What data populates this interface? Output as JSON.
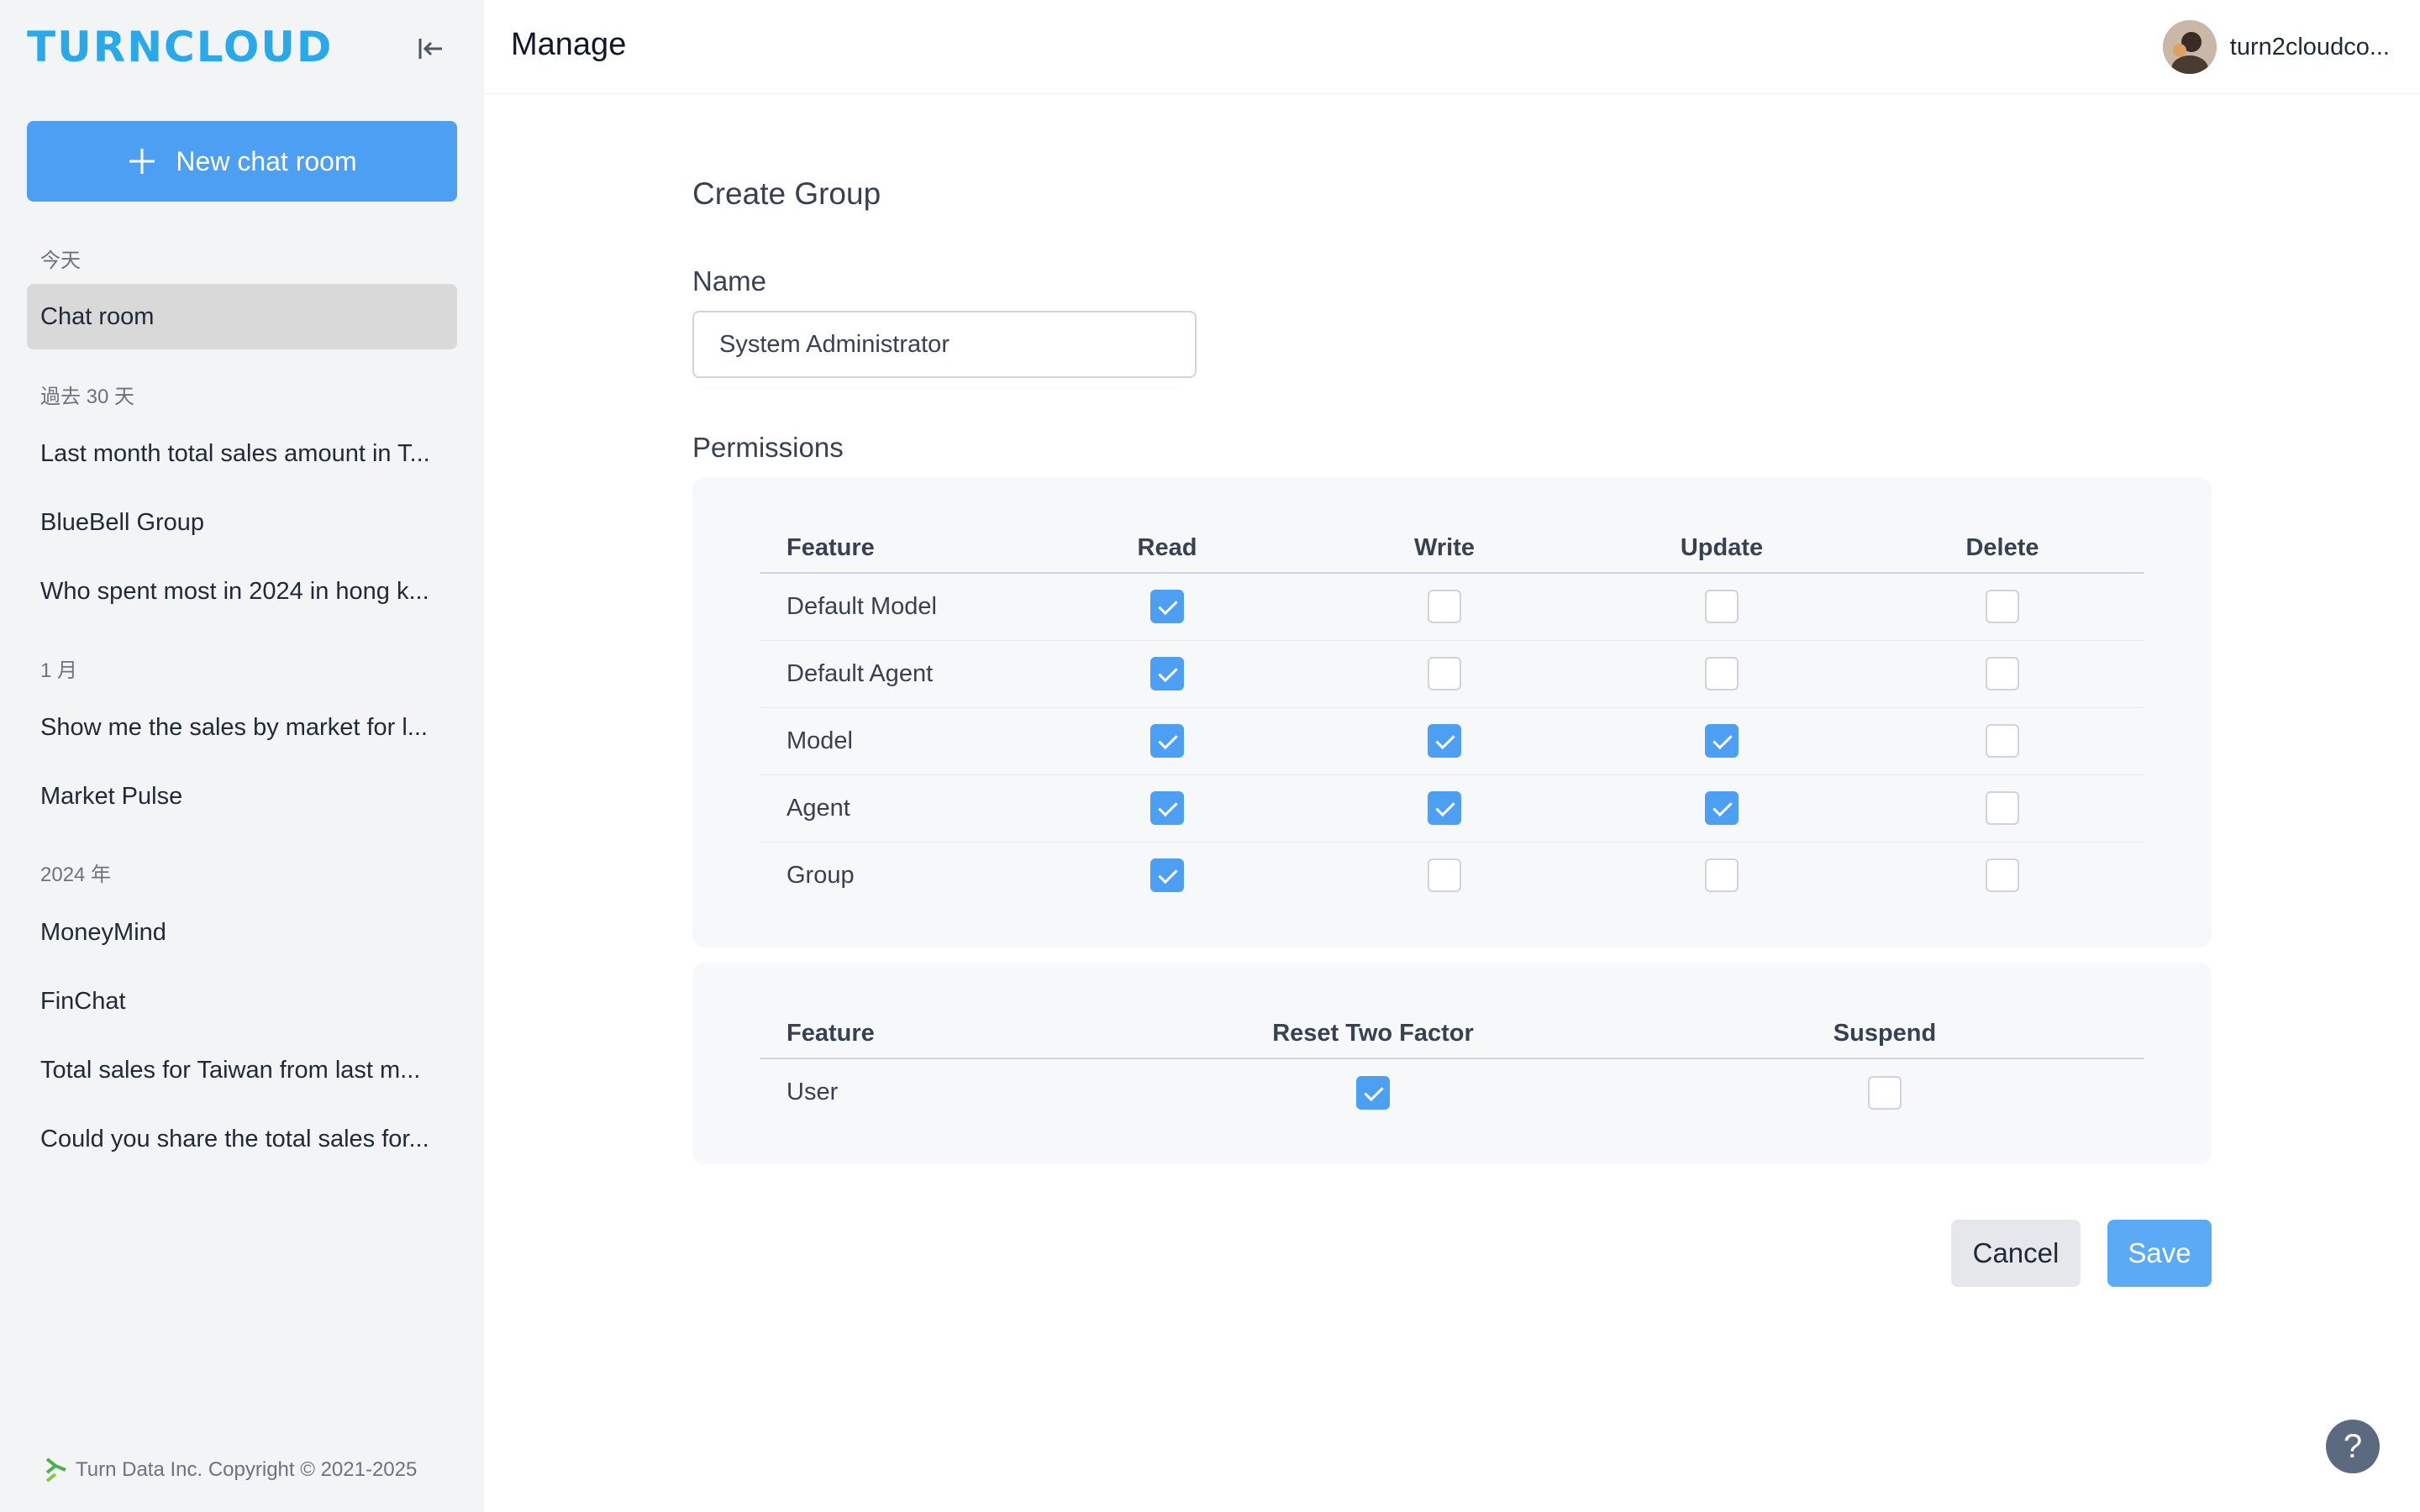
{
  "sidebar": {
    "logo_text": "TURNCLOUD",
    "new_chat_label": "New chat room",
    "sections": {
      "today": "今天",
      "past30": "過去 30 天",
      "january": "1 月",
      "year2024": "2024 年"
    },
    "items": [
      {
        "label": "Chat room"
      },
      {
        "label": "Last month total sales amount in T..."
      },
      {
        "label": "BlueBell Group"
      },
      {
        "label": "Who spent most in 2024 in hong k..."
      },
      {
        "label": "Show me the sales by market for l..."
      },
      {
        "label": "Market Pulse"
      },
      {
        "label": "MoneyMind"
      },
      {
        "label": "FinChat"
      },
      {
        "label": "Total sales for Taiwan from last m..."
      },
      {
        "label": "Could you share the total sales for..."
      }
    ],
    "footer": "Turn Data Inc. Copyright © 2021-2025"
  },
  "header": {
    "title": "Manage",
    "user_name": "turn2cloudco..."
  },
  "form": {
    "title": "Create Group",
    "name_label": "Name",
    "name_value": "System Administrator",
    "permissions_label": "Permissions",
    "table1": {
      "headers": {
        "feature": "Feature",
        "read": "Read",
        "write": "Write",
        "update": "Update",
        "delete": "Delete"
      },
      "rows": [
        {
          "feature": "Default Model",
          "read": true,
          "write": false,
          "update": false,
          "delete": false
        },
        {
          "feature": "Default Agent",
          "read": true,
          "write": false,
          "update": false,
          "delete": false
        },
        {
          "feature": "Model",
          "read": true,
          "write": true,
          "update": true,
          "delete": false
        },
        {
          "feature": "Agent",
          "read": true,
          "write": true,
          "update": true,
          "delete": false
        },
        {
          "feature": "Group",
          "read": true,
          "write": false,
          "update": false,
          "delete": false
        }
      ]
    },
    "table2": {
      "headers": {
        "feature": "Feature",
        "reset": "Reset Two Factor",
        "suspend": "Suspend"
      },
      "rows": [
        {
          "feature": "User",
          "reset": true,
          "suspend": false
        }
      ]
    },
    "cancel_label": "Cancel",
    "save_label": "Save"
  },
  "help_label": "?",
  "colors": {
    "accent": "#4c9ff2",
    "logo": "#2aa9ea",
    "sidebar_bg": "#f3f4f6",
    "card_bg": "#f7f8fa"
  }
}
